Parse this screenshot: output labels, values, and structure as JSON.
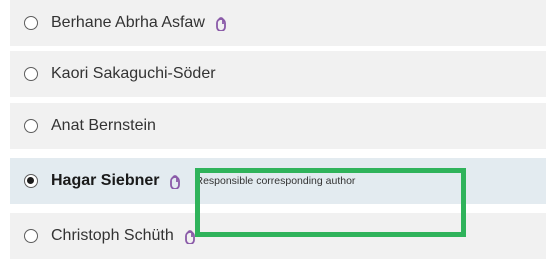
{
  "authors": [
    {
      "name": "Berhane Abrha Asfaw",
      "selected": false,
      "orcid": true,
      "role": ""
    },
    {
      "name": "Kaori Sakaguchi-Söder",
      "selected": false,
      "orcid": false,
      "role": ""
    },
    {
      "name": "Anat Bernstein",
      "selected": false,
      "orcid": false,
      "role": ""
    },
    {
      "name": "Hagar Siebner",
      "selected": true,
      "orcid": true,
      "role": "Responsible corresponding author"
    },
    {
      "name": "Christoph Schüth",
      "selected": false,
      "orcid": true,
      "role": ""
    }
  ],
  "icons": {
    "radio_unchecked": "radio-unchecked-icon",
    "radio_checked": "radio-checked-icon",
    "author_link": "orcid-link-icon"
  },
  "colors": {
    "row_background": "#f1f1f1",
    "selected_row_background": "#e3ebf0",
    "highlight_border": "#2fb35b",
    "icon_purple": "#8a5aa8"
  }
}
